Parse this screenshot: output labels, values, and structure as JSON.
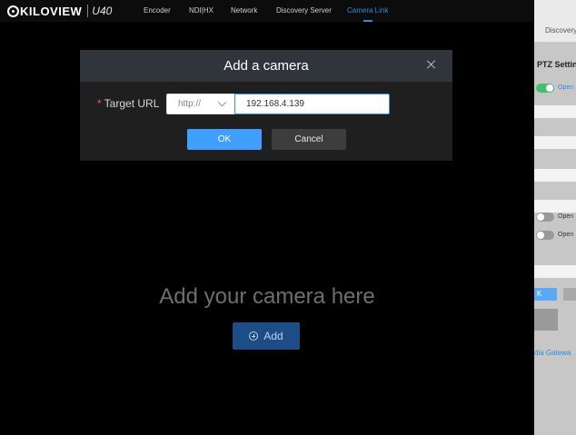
{
  "nav": {
    "brand": "KILOVIEW",
    "model": "U40",
    "items": [
      "Encoder",
      "NDI|HX",
      "Network",
      "Discovery Server",
      "Camera Link"
    ],
    "active_index": 4
  },
  "main": {
    "empty_title": "Add your camera here",
    "add_label": "Add"
  },
  "modal": {
    "title": "Add a camera",
    "field_label": "Target URL",
    "required_mark": "*",
    "protocol": "http://",
    "url_value": "192.168.4.139",
    "ok_label": "OK",
    "cancel_label": "Cancel"
  },
  "side_window": {
    "top_label": "Discovery S",
    "ptz_title": "PTZ Settin",
    "open_label": "Open",
    "link_label": "dia Gatewa"
  },
  "colors": {
    "accent": "#409eff",
    "active_nav": "#2f8cd9",
    "toggle_on": "#43c06e"
  }
}
